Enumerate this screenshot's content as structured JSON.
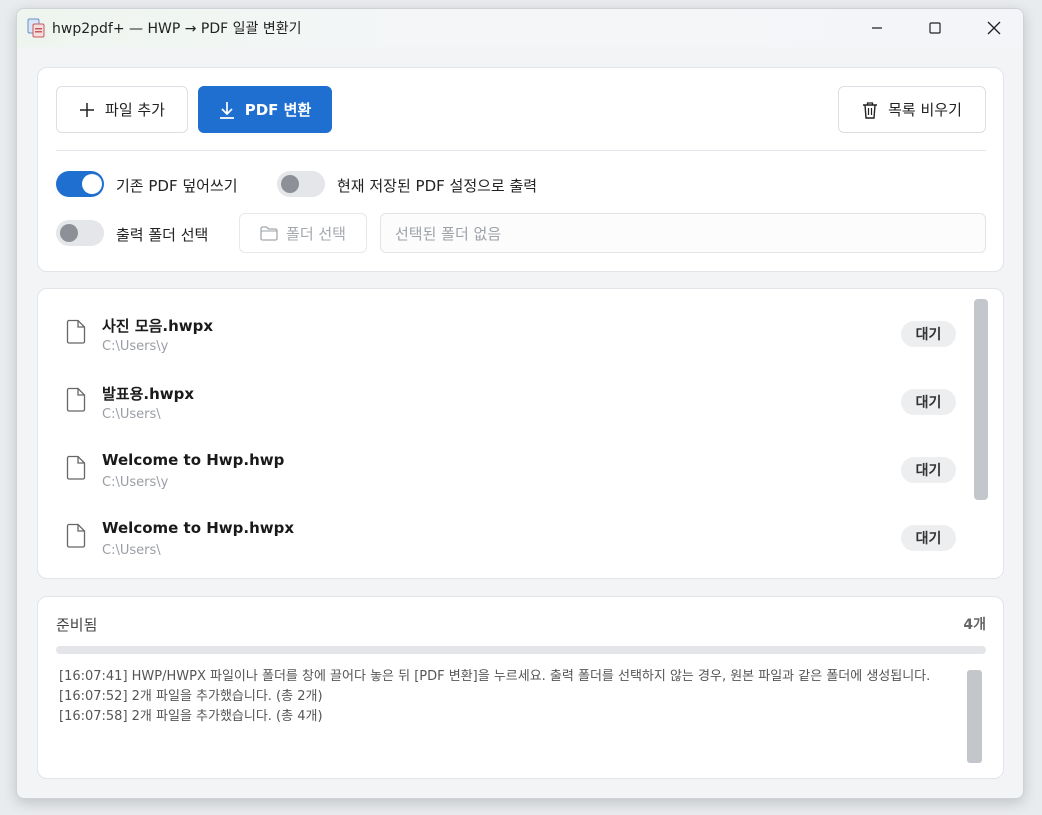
{
  "window": {
    "title": "hwp2pdf+ — HWP → PDF 일괄 변환기"
  },
  "toolbar": {
    "add_label": "파일 추가",
    "convert_label": "PDF 변환",
    "clear_label": "목록 비우기"
  },
  "options": {
    "overwrite_label": "기존 PDF 덮어쓰기",
    "overwrite_on": true,
    "use_saved_settings_label": "현재 저장된 PDF 설정으로 출력",
    "use_saved_settings_on": false,
    "output_folder_label": "출력 폴더 선택",
    "output_folder_on": false,
    "folder_button_label": "폴더 선택",
    "folder_path_placeholder": "선택된 폴더 없음"
  },
  "files": [
    {
      "name": "사진 모음.hwpx",
      "path": "C:\\Users\\y",
      "status": "대기"
    },
    {
      "name": "발표용.hwpx",
      "path": "C:\\Users\\",
      "status": "대기"
    },
    {
      "name": "Welcome to Hwp.hwp",
      "path": "C:\\Users\\y",
      "status": "대기"
    },
    {
      "name": "Welcome to Hwp.hwpx",
      "path": "C:\\Users\\",
      "status": "대기"
    }
  ],
  "log": {
    "status": "준비됨",
    "count": "4개",
    "progress": 0,
    "lines": [
      "[16:07:41] HWP/HWPX 파일이나 폴더를 창에 끌어다 놓은 뒤 [PDF 변환]을 누르세요. 출력 폴더를 선택하지 않는 경우, 원본 파일과 같은 폴더에 생성됩니다.",
      "[16:07:52] 2개 파일을 추가했습니다. (총 2개)",
      "[16:07:58] 2개 파일을 추가했습니다. (총 4개)"
    ]
  },
  "colors": {
    "accent": "#1f6fd1",
    "badge_bg": "#eceef0"
  }
}
